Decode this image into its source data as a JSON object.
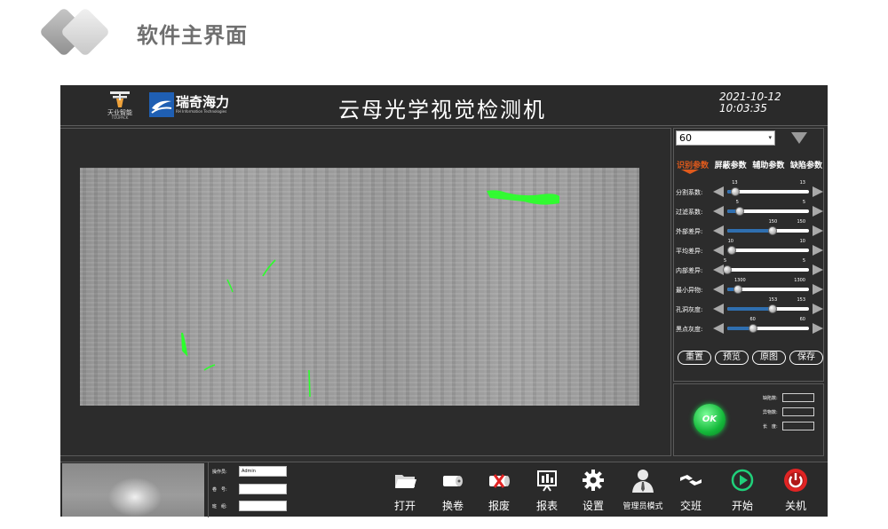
{
  "page": {
    "title": "软件主界面"
  },
  "header": {
    "logo1": {
      "name": "天业智能",
      "sub": "TOUPACK"
    },
    "logo2": {
      "name": "瑞奇海力",
      "sub": "RH Information Technologies"
    },
    "title": "云母光学视觉检测机",
    "date": "2021-10-12",
    "time": "10:03:35"
  },
  "params": {
    "select_value": "60",
    "tabs": [
      "识别参数",
      "屏蔽参数",
      "辅助参数",
      "缺陷参数"
    ],
    "active_tab": 0,
    "rows": [
      {
        "label": "分割系数:",
        "value": 13,
        "max": 13,
        "fraction": 0.1
      },
      {
        "label": "过滤系数:",
        "value": 5,
        "max": 5,
        "fraction": 0.15
      },
      {
        "label": "外部差异:",
        "value": 150,
        "max": 150,
        "fraction": 0.55
      },
      {
        "label": "平均差异:",
        "value": 10,
        "max": 10,
        "fraction": 0.05
      },
      {
        "label": "内部差异:",
        "value": 5,
        "max": 5,
        "fraction": 0.0
      },
      {
        "label": "最小异物:",
        "value": 1300,
        "max": 1300,
        "fraction": 0.13
      },
      {
        "label": "孔洞灰度:",
        "value": 153,
        "max": 153,
        "fraction": 0.55
      },
      {
        "label": "黑点灰度:",
        "value": 60,
        "max": 60,
        "fraction": 0.32
      }
    ],
    "buttons": {
      "reset": "重置",
      "preview": "预览",
      "original": "原图",
      "save": "保存"
    }
  },
  "result": {
    "status": "OK",
    "stats": [
      {
        "label": "缺陷数:",
        "value": ""
      },
      {
        "label": "异物数:",
        "value": ""
      },
      {
        "label": "长　度:",
        "value": ""
      }
    ]
  },
  "info": {
    "operator_label": "操作员:",
    "operator_value": "Admin",
    "roll_label": "卷　号:",
    "roll_value": "",
    "shift_label": "班　组:",
    "shift_value": ""
  },
  "toolbar": {
    "open": "打开",
    "change_roll": "换卷",
    "scrap": "报废",
    "report": "报表",
    "settings": "设置",
    "admin_mode": "管理员模式",
    "handover": "交班",
    "start": "开始",
    "shutdown": "关机"
  },
  "colors": {
    "app_bg": "#2e2e2e",
    "accent_tab": "#e05a1c",
    "slider_fill": "#2f6fb0",
    "ok_green": "#14b83a",
    "start_green": "#20d07a",
    "shutdown_red": "#e02424",
    "defect_green": "#2bff2b"
  }
}
